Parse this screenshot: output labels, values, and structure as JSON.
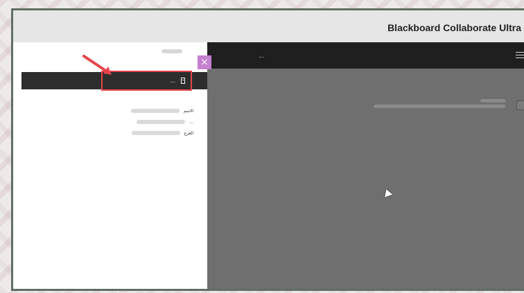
{
  "window": {
    "title": "Blackboard Collaborate Ultra"
  },
  "sidebar": {
    "selected_item": "...",
    "fields": [
      {
        "label": "الاسم",
        "value": ""
      },
      {
        "label": "...",
        "value": ""
      },
      {
        "label": "الفرع",
        "value": ""
      }
    ]
  },
  "topbar": {
    "label": "..."
  },
  "colors": {
    "accent_purple": "#c37fd0",
    "highlight_red": "#e8434a",
    "titlebar_bg": "#e6e6e6",
    "main_bg": "#6f6f6f",
    "dark_bar": "#1f1f1f"
  },
  "icons": {
    "close_tab": "x-icon",
    "menu": "hamburger-icon",
    "document": "document-icon",
    "cursor": "mouse-cursor-icon",
    "arrow": "red-arrow-icon"
  }
}
